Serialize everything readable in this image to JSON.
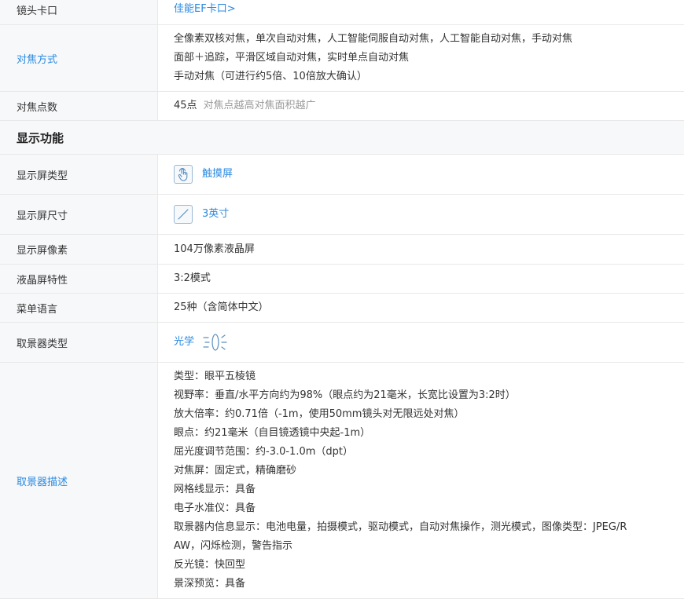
{
  "rows": {
    "mount": {
      "label": "镜头卡口",
      "value": "佳能EF卡口>"
    },
    "af_method": {
      "label": "对焦方式",
      "lines": [
        "全像素双核对焦，单次自动对焦，人工智能伺服自动对焦，人工智能自动对焦，手动对焦",
        "面部＋追踪，平滑区域自动对焦，实时单点自动对焦",
        "手动对焦（可进行约5倍、10倍放大确认）"
      ]
    },
    "af_points": {
      "label": "对焦点数",
      "value": "45点",
      "hint": "对焦点越高对焦面积越广"
    }
  },
  "section": {
    "title": "显示功能"
  },
  "display": {
    "screen_type": {
      "label": "显示屏类型",
      "value": "触摸屏",
      "icon": "touch-icon"
    },
    "screen_size": {
      "label": "显示屏尺寸",
      "value": "3英寸",
      "icon": "screen-diagonal-icon"
    },
    "screen_pixels": {
      "label": "显示屏像素",
      "value": "104万像素液晶屏"
    },
    "lcd_feature": {
      "label": "液晶屏特性",
      "value": "3:2模式"
    },
    "menu_language": {
      "label": "菜单语言",
      "value": "25种（含简体中文）"
    },
    "viewfinder_type": {
      "label": "取景器类型",
      "value": "光学",
      "icon": "optical-viewfinder-icon"
    },
    "viewfinder_desc": {
      "label": "取景器描述",
      "lines": [
        "类型：眼平五棱镜",
        "视野率：垂直/水平方向约为98%（眼点约为21毫米，长宽比设置为3:2时）",
        "放大倍率：约0.71倍（-1m，使用50mm镜头对无限远处对焦）",
        "眼点：约21毫米（自目镜透镜中央起-1m）",
        "屈光度调节范围：约-3.0-1.0m（dpt）",
        "对焦屏：固定式，精确磨砂",
        "网格线显示：具备",
        "电子水准仪：具备",
        "取景器内信息显示：电池电量，拍摄模式，驱动模式，自动对焦操作，测光模式，图像类型：JPEG/R",
        "AW，闪烁检测，警告指示",
        "反光镜：快回型",
        "景深预览：具备"
      ]
    }
  },
  "colors": {
    "link": "#2a8ae0",
    "label_bg": "#f7f8fa",
    "border": "#e8e8e8",
    "hint": "#999999"
  }
}
